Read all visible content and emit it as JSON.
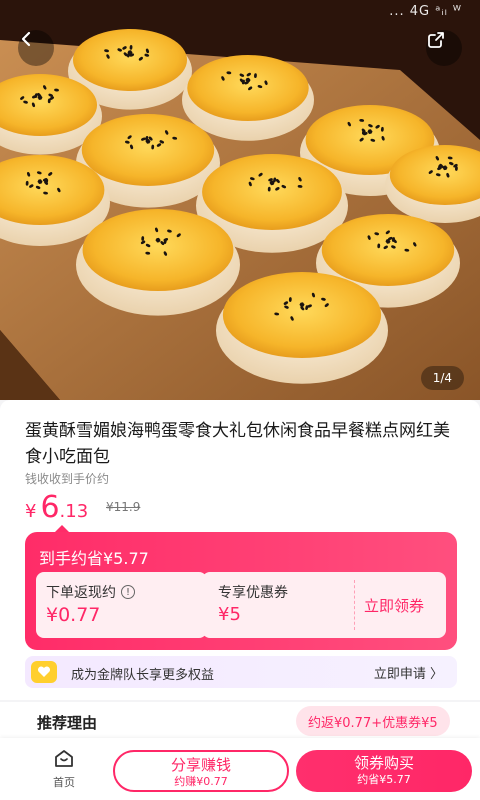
{
  "status_bar": {
    "text": "... 4G ᵃᵢₗ ᵂ"
  },
  "hero": {
    "counter": "1/4"
  },
  "product": {
    "title": "蛋黄酥雪媚娘海鸭蛋零食大礼包休闲食品早餐糕点网红美食小吃面包",
    "price_label": "钱收收到手价约",
    "price_currency": "¥",
    "price_int": "6",
    "price_dec": ".13",
    "original_price": "¥11.9"
  },
  "savings": {
    "title": "到手约省¥5.77",
    "rebate_label": "下单返现约",
    "rebate_info": "!",
    "rebate_value": "¥0.77",
    "coupon_label": "专享优惠券",
    "coupon_value": "¥5",
    "coupon_claim": "立即领券"
  },
  "vip": {
    "text": "成为金牌队长享更多权益",
    "apply": "立即申请 〉"
  },
  "reason": {
    "title": "推荐理由",
    "pill": "约返¥0.77+优惠券¥5"
  },
  "bottom": {
    "home_label": "首页",
    "share_main": "分享赚钱",
    "share_sub": "约赚¥0.77",
    "buy_main": "领券购买",
    "buy_sub": "约省¥5.77"
  },
  "colors": {
    "accent": "#ff2767",
    "pale": "#ffeef2",
    "vip_bg": "#f4e9ff"
  },
  "icons": {
    "back": "chevron-left-icon",
    "share": "share-icon",
    "home": "home-icon",
    "vip": "heart-badge-icon"
  }
}
